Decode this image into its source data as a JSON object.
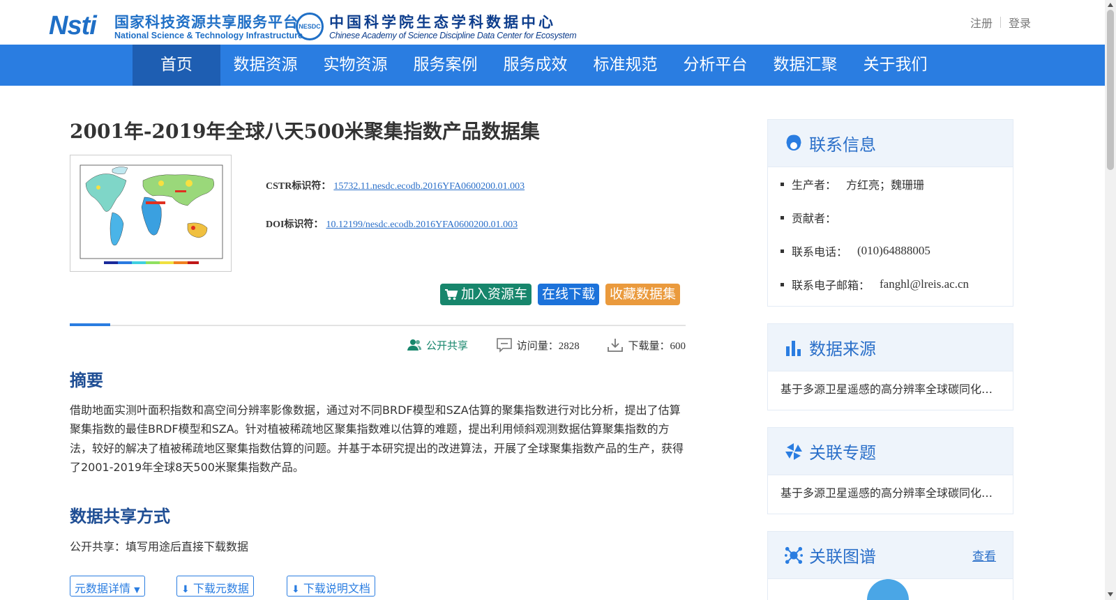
{
  "header": {
    "cnsti_mark": "Nsti",
    "cnsti_zh": "国家科技资源共享服务平台",
    "cnsti_en": "National Science & Technology Infrastructure",
    "nesdc_badge": "NESDC",
    "nesdc_zh": "中国科学院生态学科数据中心",
    "nesdc_en": "Chinese Academy of Science Discipline Data Center for Ecosystem",
    "register": "注册",
    "login": "登录"
  },
  "nav": {
    "items": [
      "首页",
      "数据资源",
      "实物资源",
      "服务案例",
      "服务成效",
      "标准规范",
      "分析平台",
      "数据汇聚",
      "关于我们"
    ],
    "active_index": 0
  },
  "dataset": {
    "title": "2001年-2019年全球八天500米聚集指数产品数据集",
    "cstr_label": "CSTR标识符：",
    "cstr_value": "15732.11.nesdc.ecodb.2016YFA0600200.01.003",
    "doi_label": "DOI标识符：",
    "doi_value": "10.12199/nesdc.ecodb.2016YFA0600200.01.003"
  },
  "actions": {
    "cart": "加入资源车",
    "download": "在线下载",
    "favorite": "收藏数据集"
  },
  "stats": {
    "share": "公开共享",
    "visits": "访问量：2828",
    "downloads": "下载量：600"
  },
  "abstract": {
    "heading": "摘要",
    "text": "借助地面实测叶面积指数和高空间分辨率影像数据，通过对不同BRDF模型和SZA估算的聚集指数进行对比分析，提出了估算聚集指数的最佳BRDF模型和SZA。针对植被稀疏地区聚集指数难以估算的难题，提出利用倾斜观测数据估算聚集指数的方法，较好的解决了植被稀疏地区聚集指数估算的问题。并基于本研究提出的改进算法，开展了全球聚集指数产品的生产，获得了2001-2019年全球8天500米聚集指数产品。"
  },
  "sharing": {
    "heading": "数据共享方式",
    "text": "公开共享：填写用途后直接下载数据"
  },
  "sub_buttons": {
    "meta_detail": "元数据详情",
    "download_meta": "下载元数据",
    "download_doc": "下载说明文档"
  },
  "sidebar": {
    "contact": {
      "title": "联系信息",
      "producer_label": "生产者：",
      "producer_value": "方红亮；魏珊珊",
      "contributor_label": "贡献者：",
      "phone_label": "联系电话：",
      "phone_value": "(010)64888005",
      "email_label": "联系电子邮箱：",
      "email_value": "fanghl@lreis.ac.cn"
    },
    "source": {
      "title": "数据来源",
      "text": "基于多源卫星遥感的高分辨率全球碳同化系统研究"
    },
    "topic": {
      "title": "关联专题",
      "text": "基于多源卫星遥感的高分辨率全球碳同化系统研究"
    },
    "graph": {
      "title": "关联图谱",
      "more": "查看"
    }
  },
  "colors": {
    "nav_bg": "#2a7de1",
    "nav_active": "#1e5eb2",
    "link": "#2a6fc9",
    "cart_btn": "#17866c",
    "download_btn": "#1c72da",
    "favorite_btn": "#ea9a3d"
  }
}
